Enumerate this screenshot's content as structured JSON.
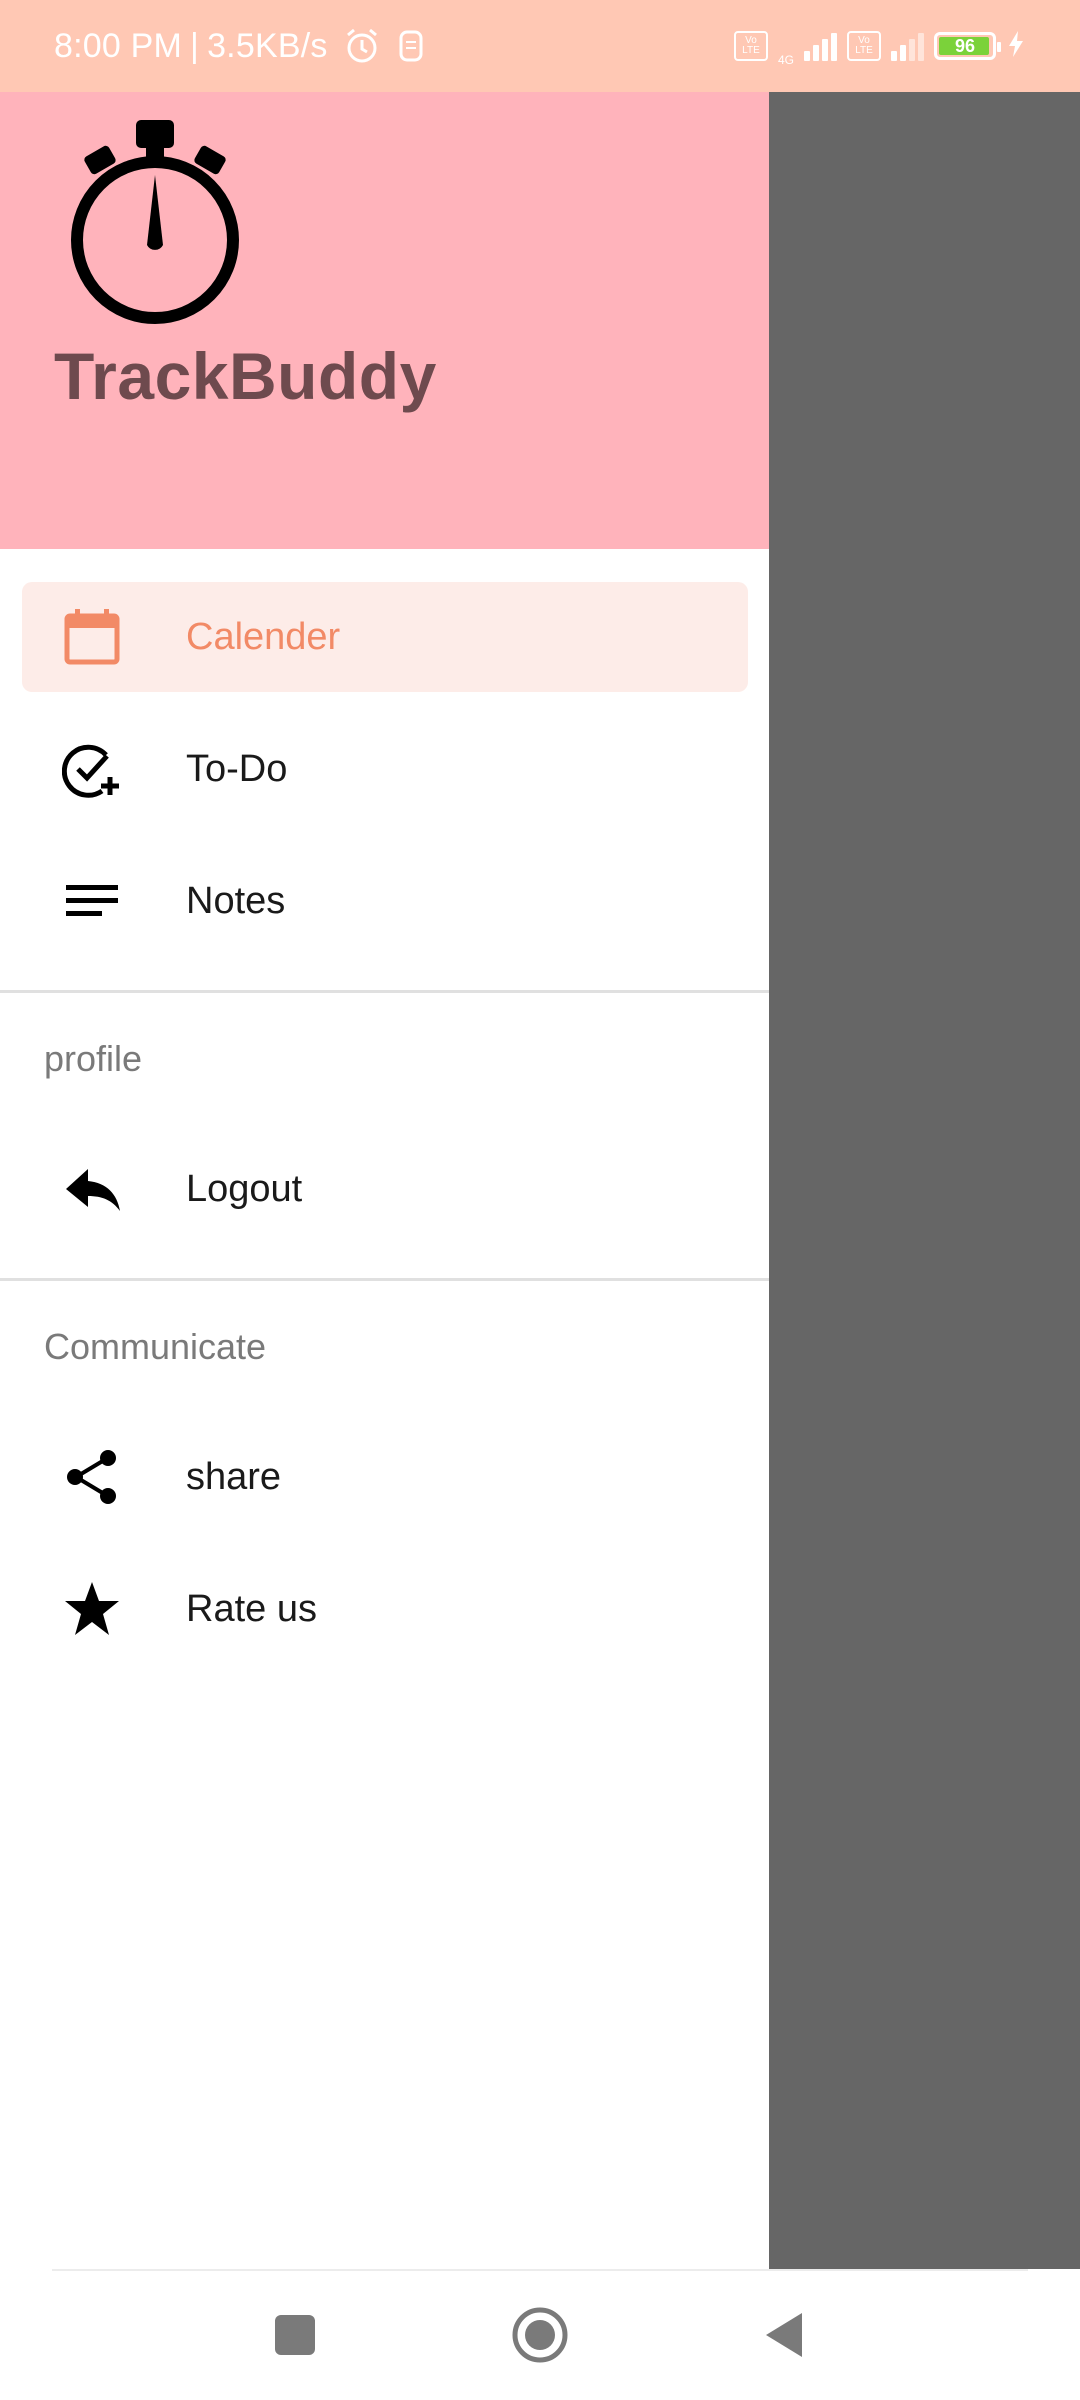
{
  "status_bar": {
    "time": "8:00 PM",
    "separator": "|",
    "speed": "3.5KB/s",
    "volte1": "Vo LTE",
    "network": "4G",
    "volte2": "Vo LTE",
    "battery": "96",
    "battery_level": 0.96
  },
  "header": {
    "app_name": "TrackBuddy",
    "logo_icon": "stopwatch-icon",
    "background": "#ffb3bb"
  },
  "menu": {
    "items": [
      {
        "label": "Calender",
        "icon": "calendar-icon",
        "selected": true
      },
      {
        "label": "To-Do",
        "icon": "check-circle-plus-icon",
        "selected": false
      },
      {
        "label": "Notes",
        "icon": "notes-lines-icon",
        "selected": false
      }
    ],
    "sections": [
      {
        "title": "profile",
        "items": [
          {
            "label": "Logout",
            "icon": "reply-icon"
          }
        ]
      },
      {
        "title": "Communicate",
        "items": [
          {
            "label": "share",
            "icon": "share-icon"
          },
          {
            "label": "Rate us",
            "icon": "star-icon"
          }
        ]
      }
    ]
  },
  "colors": {
    "accent": "#f28a66",
    "selected_bg": "#fdece8",
    "status_bar": "#ffc8b4",
    "scrim": "#666666"
  },
  "nav_bar": {
    "icons": [
      "recents-square-icon",
      "home-circle-icon",
      "back-triangle-icon"
    ]
  }
}
